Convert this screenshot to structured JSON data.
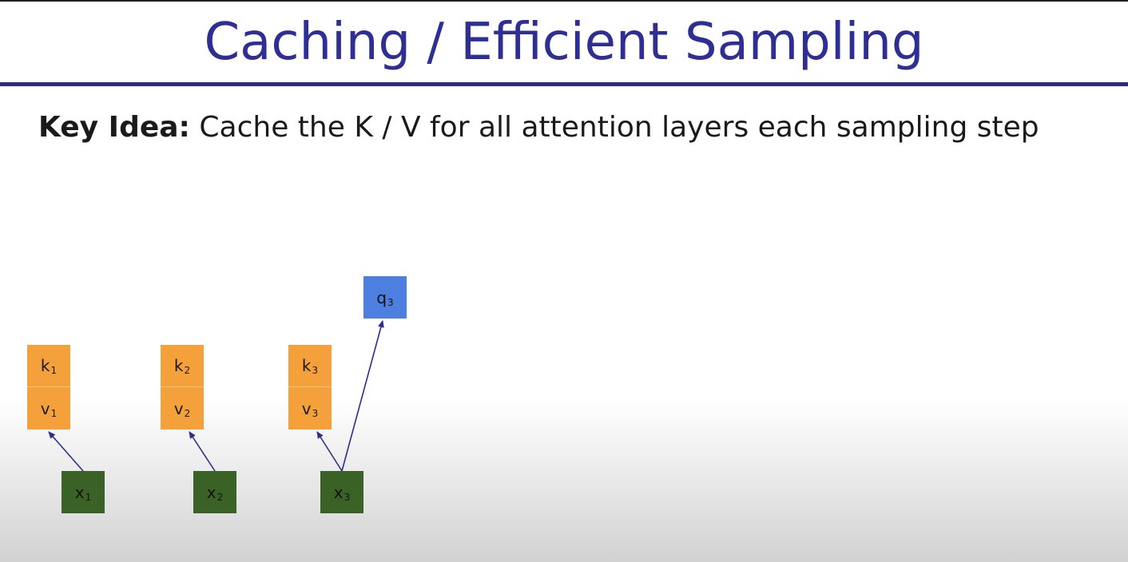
{
  "slide": {
    "title": "Caching / Efficient Sampling",
    "key_idea_label": "Key Idea:",
    "key_idea_text": " Cache the K / V for all attention layers each sampling step"
  },
  "diagram": {
    "columns": [
      {
        "key": {
          "symbol": "k",
          "index": "1"
        },
        "value": {
          "symbol": "v",
          "index": "1"
        },
        "input": {
          "symbol": "x",
          "index": "1"
        }
      },
      {
        "key": {
          "symbol": "k",
          "index": "2"
        },
        "value": {
          "symbol": "v",
          "index": "2"
        },
        "input": {
          "symbol": "x",
          "index": "2"
        }
      },
      {
        "key": {
          "symbol": "k",
          "index": "3"
        },
        "value": {
          "symbol": "v",
          "index": "3"
        },
        "input": {
          "symbol": "x",
          "index": "3"
        },
        "query": {
          "symbol": "q",
          "index": "3"
        }
      }
    ],
    "colors": {
      "kv": "#f4a13c",
      "input": "#3b6226",
      "query": "#4c7fe0",
      "arrow": "#2e2e8a",
      "title": "#2e2e94"
    }
  }
}
